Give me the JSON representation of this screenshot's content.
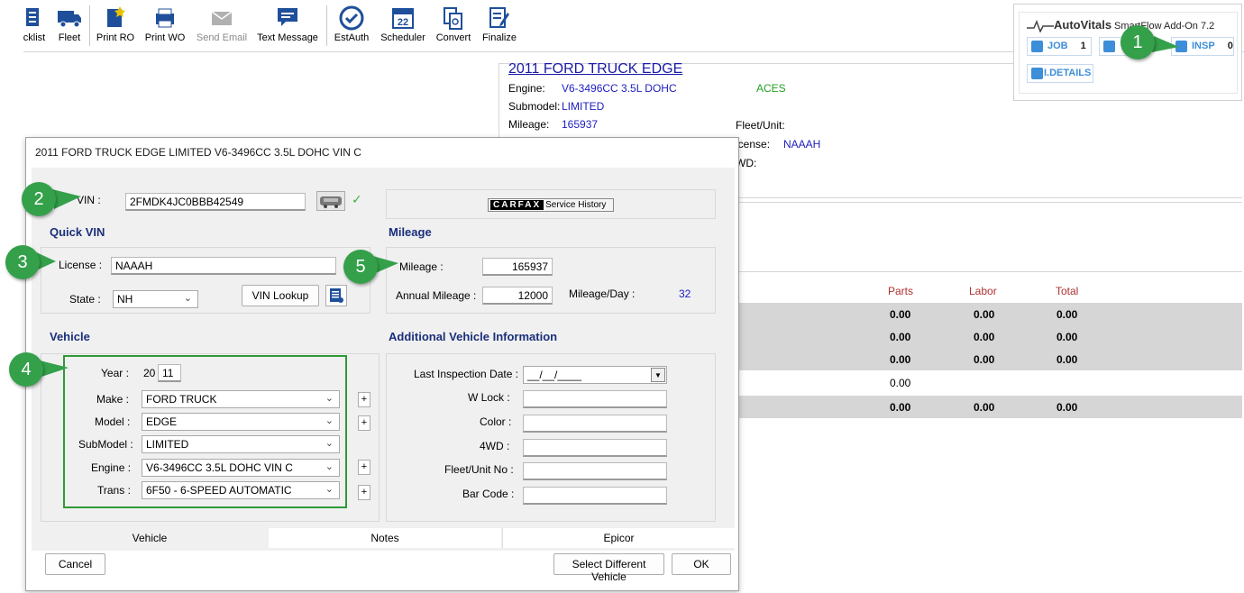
{
  "toolbar": {
    "items": [
      {
        "label": "cklist",
        "icon": "checklist-icon",
        "enabled": true
      },
      {
        "label": "Fleet",
        "icon": "truck-icon",
        "enabled": true
      },
      {
        "label": "Print RO",
        "icon": "print-ro-icon",
        "enabled": true
      },
      {
        "label": "Print WO",
        "icon": "printer-icon",
        "enabled": true
      },
      {
        "label": "Send Email",
        "icon": "envelope-icon",
        "enabled": false
      },
      {
        "label": "Text Message",
        "icon": "chat-icon",
        "enabled": true
      },
      {
        "label": "EstAuth",
        "icon": "check-circle-icon",
        "enabled": true
      },
      {
        "label": "Scheduler",
        "icon": "calendar-icon",
        "enabled": true
      },
      {
        "label": "Convert",
        "icon": "convert-icon",
        "enabled": true
      },
      {
        "label": "Finalize",
        "icon": "finalize-icon",
        "enabled": true
      }
    ],
    "calendar_day": "22"
  },
  "vehicle_panel": {
    "title": "2011 FORD TRUCK EDGE",
    "engine_label": "Engine:",
    "engine_value": "V6-3496CC 3.5L DOHC",
    "aces": "ACES",
    "submodel_label": "Submodel:",
    "submodel_value": "LIMITED",
    "mileage_label": "Mileage:",
    "mileage_value": "165937",
    "fleet_label": "Fleet/Unit:",
    "license_label": "icense:",
    "license_value": "NAAAH",
    "wd_label": "WD:"
  },
  "totals": {
    "headers": [
      "Parts",
      "Labor",
      "Total"
    ],
    "rows": [
      {
        "parts": "0.00",
        "labor": "0.00",
        "total": "0.00",
        "shaded": true
      },
      {
        "parts": "0.00",
        "labor": "0.00",
        "total": "0.00",
        "shaded": true
      },
      {
        "parts": "0.00",
        "labor": "0.00",
        "total": "0.00",
        "shaded": true
      },
      {
        "parts": "0.00",
        "labor": "",
        "total": "",
        "shaded": false
      },
      {
        "parts": "0.00",
        "labor": "0.00",
        "total": "0.00",
        "shaded": true
      }
    ]
  },
  "autovitals": {
    "logo": "AutoVitals",
    "addon": "SmartFlow Add-On 7.2",
    "job_label": "JOB",
    "job_count": "1",
    "insp_label": "INSP",
    "insp_count": "0",
    "details_label": "I.DETAILS"
  },
  "dialog": {
    "title": "2011 FORD TRUCK EDGE LIMITED V6-3496CC 3.5L DOHC VIN C",
    "vin_label": "VIN :",
    "vin_value": "2FMDK4JC0BBB42549",
    "carfax_label": "CARFAX",
    "carfax_service": "Service History",
    "quick_vin_heading": "Quick VIN",
    "license_label": "License :",
    "license_value": "NAAAH",
    "state_label": "State :",
    "state_value": "NH",
    "vin_lookup": "VIN Lookup",
    "mileage_heading": "Mileage",
    "mileage_label": "Mileage :",
    "mileage_value": "165937",
    "annual_label": "Annual Mileage :",
    "annual_value": "12000",
    "per_day_label": "Mileage/Day :",
    "per_day_value": "32",
    "vehicle_heading": "Vehicle",
    "year_label": "Year :",
    "year_prefix": "20",
    "year_value": "11",
    "make_label": "Make :",
    "make_value": "FORD TRUCK",
    "model_label": "Model :",
    "model_value": "EDGE",
    "submodel_label": "SubModel :",
    "submodel_value": "LIMITED",
    "engine_label": "Engine :",
    "engine_value": "V6-3496CC 3.5L DOHC VIN C",
    "trans_label": "Trans :",
    "trans_value": "6F50 - 6-SPEED AUTOMATIC",
    "addl_heading": "Additional Vehicle Information",
    "last_insp_label": "Last Inspection Date :",
    "last_insp_value": "__/__/____",
    "wlock_label": "W Lock :",
    "color_label": "Color :",
    "fourwd_label": "4WD :",
    "fleet_label": "Fleet/Unit No :",
    "barcode_label": "Bar Code :",
    "tabs": [
      "Vehicle",
      "Notes",
      "Epicor"
    ],
    "cancel": "Cancel",
    "select_diff": "Select Different Vehicle",
    "ok": "OK"
  },
  "callouts": [
    "1",
    "2",
    "3",
    "4",
    "5"
  ],
  "colors": {
    "callout": "#34a04a",
    "heading": "#1a2f7a",
    "link_blue": "#1a1aa6",
    "totals_header": "#b03030"
  }
}
